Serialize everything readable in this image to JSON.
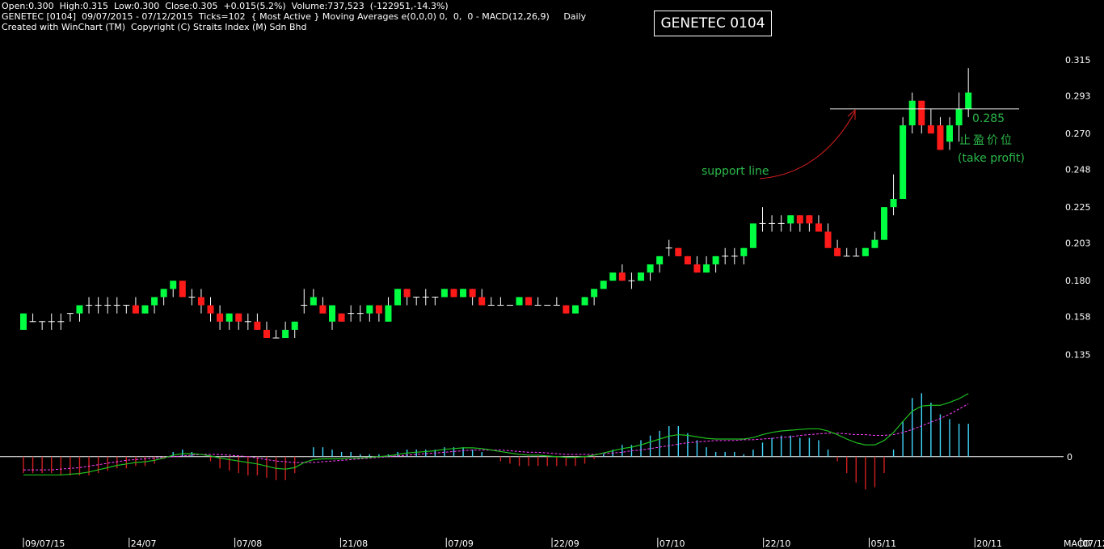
{
  "header": {
    "line1": "Open:0.300  High:0.315  Low:0.300  Close:0.305  +0.015(5.2%)  Volume:737,523  (-122951,-14.3%)",
    "line2": "GENETEC [0104]  09/07/2015 - 07/12/2015  Ticks=102  { Most Active } Moving Averages e(0,0,0) 0,  0,  0 - MACD(12,26,9)     Daily",
    "line3": "Created with WinChart (TM)  Copyright (C) Straits Index (M) Sdn Bhd",
    "title_box": "GENETEC 0104"
  },
  "colors": {
    "up": "#00ff40",
    "down": "#ff1a1a",
    "annotation": "#2bb84a",
    "arrow": "#e02020",
    "macd": "#20c020",
    "signal": "#ff40ff",
    "hist_up": "#40d8ff",
    "hist_down": "#d02020"
  },
  "annotations": {
    "support_line": "support line",
    "tp_value": "0.285",
    "tp_cn": "止盈价位",
    "tp_en": "(take profit)"
  },
  "x_ticks": [
    "09/07/15",
    "24/07",
    "07/08",
    "21/08",
    "07/09",
    "22/09",
    "07/10",
    "22/10",
    "05/11",
    "20/11",
    "07/12"
  ],
  "macd_label": "MACD",
  "chart_data": [
    {
      "type": "candlestick",
      "title": "GENETEC 0104",
      "y_ticks": [
        0.315,
        0.293,
        0.27,
        0.248,
        0.225,
        0.203,
        0.18,
        0.158,
        0.135
      ],
      "ylim": [
        0.1292,
        0.317
      ],
      "support_level": 0.285,
      "ohlc": [
        [
          0.15,
          0.16,
          0.15,
          0.16
        ],
        [
          0.155,
          0.16,
          0.155,
          0.155
        ],
        [
          0.155,
          0.155,
          0.15,
          0.155
        ],
        [
          0.155,
          0.16,
          0.15,
          0.155
        ],
        [
          0.155,
          0.16,
          0.15,
          0.155
        ],
        [
          0.16,
          0.16,
          0.155,
          0.16
        ],
        [
          0.16,
          0.165,
          0.155,
          0.165
        ],
        [
          0.165,
          0.17,
          0.16,
          0.165
        ],
        [
          0.165,
          0.17,
          0.16,
          0.165
        ],
        [
          0.165,
          0.17,
          0.16,
          0.165
        ],
        [
          0.165,
          0.17,
          0.16,
          0.165
        ],
        [
          0.165,
          0.165,
          0.16,
          0.165
        ],
        [
          0.165,
          0.17,
          0.16,
          0.16
        ],
        [
          0.16,
          0.165,
          0.16,
          0.165
        ],
        [
          0.165,
          0.17,
          0.16,
          0.17
        ],
        [
          0.17,
          0.175,
          0.165,
          0.175
        ],
        [
          0.175,
          0.18,
          0.17,
          0.18
        ],
        [
          0.18,
          0.18,
          0.17,
          0.17
        ],
        [
          0.17,
          0.175,
          0.165,
          0.17
        ],
        [
          0.17,
          0.175,
          0.16,
          0.165
        ],
        [
          0.165,
          0.17,
          0.155,
          0.16
        ],
        [
          0.16,
          0.165,
          0.15,
          0.155
        ],
        [
          0.155,
          0.16,
          0.15,
          0.16
        ],
        [
          0.16,
          0.16,
          0.15,
          0.155
        ],
        [
          0.155,
          0.16,
          0.15,
          0.155
        ],
        [
          0.155,
          0.16,
          0.15,
          0.15
        ],
        [
          0.15,
          0.155,
          0.145,
          0.145
        ],
        [
          0.145,
          0.15,
          0.145,
          0.145
        ],
        [
          0.145,
          0.155,
          0.145,
          0.15
        ],
        [
          0.15,
          0.155,
          0.145,
          0.155
        ],
        [
          0.165,
          0.175,
          0.16,
          0.165
        ],
        [
          0.165,
          0.175,
          0.165,
          0.17
        ],
        [
          0.165,
          0.17,
          0.16,
          0.16
        ],
        [
          0.155,
          0.165,
          0.15,
          0.165
        ],
        [
          0.16,
          0.16,
          0.155,
          0.155
        ],
        [
          0.16,
          0.165,
          0.155,
          0.16
        ],
        [
          0.16,
          0.165,
          0.155,
          0.16
        ],
        [
          0.16,
          0.165,
          0.155,
          0.165
        ],
        [
          0.165,
          0.165,
          0.155,
          0.16
        ],
        [
          0.155,
          0.17,
          0.155,
          0.165
        ],
        [
          0.165,
          0.175,
          0.165,
          0.175
        ],
        [
          0.175,
          0.175,
          0.165,
          0.17
        ],
        [
          0.17,
          0.17,
          0.165,
          0.17
        ],
        [
          0.17,
          0.175,
          0.165,
          0.17
        ],
        [
          0.17,
          0.17,
          0.165,
          0.17
        ],
        [
          0.17,
          0.175,
          0.17,
          0.175
        ],
        [
          0.175,
          0.175,
          0.17,
          0.17
        ],
        [
          0.17,
          0.175,
          0.17,
          0.175
        ],
        [
          0.175,
          0.175,
          0.165,
          0.17
        ],
        [
          0.17,
          0.175,
          0.165,
          0.165
        ],
        [
          0.165,
          0.17,
          0.165,
          0.165
        ],
        [
          0.165,
          0.17,
          0.165,
          0.165
        ],
        [
          0.165,
          0.165,
          0.165,
          0.165
        ],
        [
          0.165,
          0.17,
          0.165,
          0.17
        ],
        [
          0.17,
          0.17,
          0.165,
          0.165
        ],
        [
          0.165,
          0.17,
          0.165,
          0.165
        ],
        [
          0.165,
          0.165,
          0.165,
          0.165
        ],
        [
          0.165,
          0.17,
          0.165,
          0.165
        ],
        [
          0.165,
          0.165,
          0.16,
          0.16
        ],
        [
          0.16,
          0.165,
          0.16,
          0.165
        ],
        [
          0.165,
          0.17,
          0.165,
          0.17
        ],
        [
          0.17,
          0.175,
          0.165,
          0.175
        ],
        [
          0.175,
          0.18,
          0.175,
          0.18
        ],
        [
          0.18,
          0.185,
          0.18,
          0.185
        ],
        [
          0.185,
          0.19,
          0.18,
          0.18
        ],
        [
          0.18,
          0.185,
          0.175,
          0.18
        ],
        [
          0.18,
          0.185,
          0.18,
          0.185
        ],
        [
          0.185,
          0.19,
          0.18,
          0.19
        ],
        [
          0.19,
          0.195,
          0.185,
          0.195
        ],
        [
          0.2,
          0.205,
          0.195,
          0.2
        ],
        [
          0.2,
          0.2,
          0.195,
          0.195
        ],
        [
          0.195,
          0.195,
          0.19,
          0.19
        ],
        [
          0.19,
          0.195,
          0.185,
          0.185
        ],
        [
          0.185,
          0.195,
          0.185,
          0.19
        ],
        [
          0.19,
          0.195,
          0.185,
          0.195
        ],
        [
          0.195,
          0.2,
          0.19,
          0.195
        ],
        [
          0.195,
          0.2,
          0.19,
          0.195
        ],
        [
          0.195,
          0.2,
          0.19,
          0.2
        ],
        [
          0.2,
          0.215,
          0.2,
          0.215
        ],
        [
          0.215,
          0.225,
          0.21,
          0.215
        ],
        [
          0.215,
          0.22,
          0.21,
          0.215
        ],
        [
          0.215,
          0.22,
          0.21,
          0.215
        ],
        [
          0.215,
          0.22,
          0.21,
          0.22
        ],
        [
          0.22,
          0.22,
          0.21,
          0.215
        ],
        [
          0.22,
          0.22,
          0.21,
          0.215
        ],
        [
          0.215,
          0.22,
          0.21,
          0.21
        ],
        [
          0.21,
          0.215,
          0.205,
          0.2
        ],
        [
          0.2,
          0.205,
          0.195,
          0.195
        ],
        [
          0.195,
          0.2,
          0.195,
          0.195
        ],
        [
          0.195,
          0.2,
          0.195,
          0.195
        ],
        [
          0.195,
          0.2,
          0.195,
          0.2
        ],
        [
          0.2,
          0.21,
          0.2,
          0.205
        ],
        [
          0.205,
          0.225,
          0.205,
          0.225
        ],
        [
          0.225,
          0.245,
          0.22,
          0.23
        ],
        [
          0.23,
          0.28,
          0.23,
          0.275
        ],
        [
          0.275,
          0.295,
          0.27,
          0.29
        ],
        [
          0.29,
          0.29,
          0.27,
          0.275
        ],
        [
          0.275,
          0.285,
          0.27,
          0.27
        ],
        [
          0.275,
          0.28,
          0.26,
          0.26
        ],
        [
          0.265,
          0.28,
          0.26,
          0.275
        ],
        [
          0.275,
          0.295,
          0.265,
          0.285
        ],
        [
          0.285,
          0.31,
          0.28,
          0.295
        ]
      ]
    },
    {
      "type": "bar",
      "title": "MACD",
      "indicator": "MACD(12,26,9)",
      "zero_line": 0,
      "ylim": [
        -0.0105,
        0.011
      ],
      "macd": [
        -0.0025,
        -0.0025,
        -0.0025,
        -0.0025,
        -0.0025,
        -0.0024,
        -0.0023,
        -0.0021,
        -0.0018,
        -0.0015,
        -0.0012,
        -0.001,
        -0.0008,
        -0.0007,
        -0.0005,
        -0.0002,
        0.0002,
        0.0004,
        0.0004,
        0.0003,
        0.0001,
        -0.0002,
        -0.0004,
        -0.0006,
        -0.0008,
        -0.001,
        -0.0013,
        -0.0016,
        -0.0017,
        -0.0015,
        -0.0008,
        -0.0004,
        -0.0003,
        -0.0003,
        -0.0003,
        -0.0002,
        -0.0002,
        -0.0001,
        0.0,
        0.0001,
        0.0003,
        0.0005,
        0.0006,
        0.0007,
        0.0008,
        0.001,
        0.0011,
        0.0012,
        0.0012,
        0.0011,
        0.0009,
        0.0007,
        0.0005,
        0.0003,
        0.0002,
        0.0002,
        0.0001,
        0.0,
        -0.0001,
        -0.0001,
        0.0,
        0.0002,
        0.0005,
        0.0008,
        0.0011,
        0.0013,
        0.0016,
        0.002,
        0.0024,
        0.0028,
        0.003,
        0.0029,
        0.0027,
        0.0025,
        0.0024,
        0.0024,
        0.0024,
        0.0024,
        0.0026,
        0.003,
        0.0033,
        0.0035,
        0.0036,
        0.0037,
        0.0038,
        0.0038,
        0.0035,
        0.003,
        0.0024,
        0.0019,
        0.0016,
        0.0016,
        0.0022,
        0.0033,
        0.0048,
        0.0062,
        0.0069,
        0.007,
        0.007,
        0.0074,
        0.0079,
        0.0086
      ],
      "signal": [
        -0.0018,
        -0.0018,
        -0.0018,
        -0.0018,
        -0.0017,
        -0.0016,
        -0.0015,
        -0.0013,
        -0.0011,
        -0.0009,
        -0.0007,
        -0.0005,
        -0.0004,
        -0.0003,
        -0.0002,
        -0.0001,
        0.0,
        0.0001,
        0.0002,
        0.0003,
        0.0003,
        0.0003,
        0.0002,
        0.0001,
        0.0,
        -0.0002,
        -0.0004,
        -0.0006,
        -0.0007,
        -0.0008,
        -0.0008,
        -0.0008,
        -0.0007,
        -0.0006,
        -0.0005,
        -0.0004,
        -0.0003,
        -0.0002,
        -0.0001,
        0.0,
        0.0001,
        0.0002,
        0.0003,
        0.0004,
        0.0005,
        0.0006,
        0.0007,
        0.0008,
        0.0009,
        0.0009,
        0.0009,
        0.0009,
        0.0008,
        0.0007,
        0.0006,
        0.0006,
        0.0005,
        0.0004,
        0.0003,
        0.0003,
        0.0003,
        0.0003,
        0.0004,
        0.0005,
        0.0006,
        0.0008,
        0.0009,
        0.0011,
        0.0013,
        0.0015,
        0.0017,
        0.0019,
        0.002,
        0.0021,
        0.0022,
        0.0022,
        0.0022,
        0.0023,
        0.0023,
        0.0024,
        0.0025,
        0.0026,
        0.0027,
        0.0029,
        0.003,
        0.0031,
        0.0032,
        0.0032,
        0.0031,
        0.003,
        0.003,
        0.0029,
        0.0029,
        0.003,
        0.0033,
        0.0037,
        0.0042,
        0.0047,
        0.0052,
        0.0058,
        0.0065,
        0.0072
      ]
    }
  ]
}
